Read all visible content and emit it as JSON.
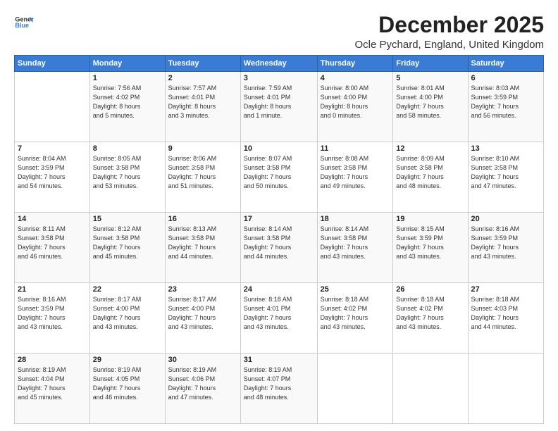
{
  "logo": {
    "line1": "General",
    "line2": "Blue"
  },
  "title": "December 2025",
  "subtitle": "Ocle Pychard, England, United Kingdom",
  "days_of_week": [
    "Sunday",
    "Monday",
    "Tuesday",
    "Wednesday",
    "Thursday",
    "Friday",
    "Saturday"
  ],
  "weeks": [
    [
      {
        "day": "",
        "info": ""
      },
      {
        "day": "1",
        "info": "Sunrise: 7:56 AM\nSunset: 4:02 PM\nDaylight: 8 hours\nand 5 minutes."
      },
      {
        "day": "2",
        "info": "Sunrise: 7:57 AM\nSunset: 4:01 PM\nDaylight: 8 hours\nand 3 minutes."
      },
      {
        "day": "3",
        "info": "Sunrise: 7:59 AM\nSunset: 4:01 PM\nDaylight: 8 hours\nand 1 minute."
      },
      {
        "day": "4",
        "info": "Sunrise: 8:00 AM\nSunset: 4:00 PM\nDaylight: 8 hours\nand 0 minutes."
      },
      {
        "day": "5",
        "info": "Sunrise: 8:01 AM\nSunset: 4:00 PM\nDaylight: 7 hours\nand 58 minutes."
      },
      {
        "day": "6",
        "info": "Sunrise: 8:03 AM\nSunset: 3:59 PM\nDaylight: 7 hours\nand 56 minutes."
      }
    ],
    [
      {
        "day": "7",
        "info": "Sunrise: 8:04 AM\nSunset: 3:59 PM\nDaylight: 7 hours\nand 54 minutes."
      },
      {
        "day": "8",
        "info": "Sunrise: 8:05 AM\nSunset: 3:58 PM\nDaylight: 7 hours\nand 53 minutes."
      },
      {
        "day": "9",
        "info": "Sunrise: 8:06 AM\nSunset: 3:58 PM\nDaylight: 7 hours\nand 51 minutes."
      },
      {
        "day": "10",
        "info": "Sunrise: 8:07 AM\nSunset: 3:58 PM\nDaylight: 7 hours\nand 50 minutes."
      },
      {
        "day": "11",
        "info": "Sunrise: 8:08 AM\nSunset: 3:58 PM\nDaylight: 7 hours\nand 49 minutes."
      },
      {
        "day": "12",
        "info": "Sunrise: 8:09 AM\nSunset: 3:58 PM\nDaylight: 7 hours\nand 48 minutes."
      },
      {
        "day": "13",
        "info": "Sunrise: 8:10 AM\nSunset: 3:58 PM\nDaylight: 7 hours\nand 47 minutes."
      }
    ],
    [
      {
        "day": "14",
        "info": "Sunrise: 8:11 AM\nSunset: 3:58 PM\nDaylight: 7 hours\nand 46 minutes."
      },
      {
        "day": "15",
        "info": "Sunrise: 8:12 AM\nSunset: 3:58 PM\nDaylight: 7 hours\nand 45 minutes."
      },
      {
        "day": "16",
        "info": "Sunrise: 8:13 AM\nSunset: 3:58 PM\nDaylight: 7 hours\nand 44 minutes."
      },
      {
        "day": "17",
        "info": "Sunrise: 8:14 AM\nSunset: 3:58 PM\nDaylight: 7 hours\nand 44 minutes."
      },
      {
        "day": "18",
        "info": "Sunrise: 8:14 AM\nSunset: 3:58 PM\nDaylight: 7 hours\nand 43 minutes."
      },
      {
        "day": "19",
        "info": "Sunrise: 8:15 AM\nSunset: 3:59 PM\nDaylight: 7 hours\nand 43 minutes."
      },
      {
        "day": "20",
        "info": "Sunrise: 8:16 AM\nSunset: 3:59 PM\nDaylight: 7 hours\nand 43 minutes."
      }
    ],
    [
      {
        "day": "21",
        "info": "Sunrise: 8:16 AM\nSunset: 3:59 PM\nDaylight: 7 hours\nand 43 minutes."
      },
      {
        "day": "22",
        "info": "Sunrise: 8:17 AM\nSunset: 4:00 PM\nDaylight: 7 hours\nand 43 minutes."
      },
      {
        "day": "23",
        "info": "Sunrise: 8:17 AM\nSunset: 4:00 PM\nDaylight: 7 hours\nand 43 minutes."
      },
      {
        "day": "24",
        "info": "Sunrise: 8:18 AM\nSunset: 4:01 PM\nDaylight: 7 hours\nand 43 minutes."
      },
      {
        "day": "25",
        "info": "Sunrise: 8:18 AM\nSunset: 4:02 PM\nDaylight: 7 hours\nand 43 minutes."
      },
      {
        "day": "26",
        "info": "Sunrise: 8:18 AM\nSunset: 4:02 PM\nDaylight: 7 hours\nand 43 minutes."
      },
      {
        "day": "27",
        "info": "Sunrise: 8:18 AM\nSunset: 4:03 PM\nDaylight: 7 hours\nand 44 minutes."
      }
    ],
    [
      {
        "day": "28",
        "info": "Sunrise: 8:19 AM\nSunset: 4:04 PM\nDaylight: 7 hours\nand 45 minutes."
      },
      {
        "day": "29",
        "info": "Sunrise: 8:19 AM\nSunset: 4:05 PM\nDaylight: 7 hours\nand 46 minutes."
      },
      {
        "day": "30",
        "info": "Sunrise: 8:19 AM\nSunset: 4:06 PM\nDaylight: 7 hours\nand 47 minutes."
      },
      {
        "day": "31",
        "info": "Sunrise: 8:19 AM\nSunset: 4:07 PM\nDaylight: 7 hours\nand 48 minutes."
      },
      {
        "day": "",
        "info": ""
      },
      {
        "day": "",
        "info": ""
      },
      {
        "day": "",
        "info": ""
      }
    ]
  ]
}
